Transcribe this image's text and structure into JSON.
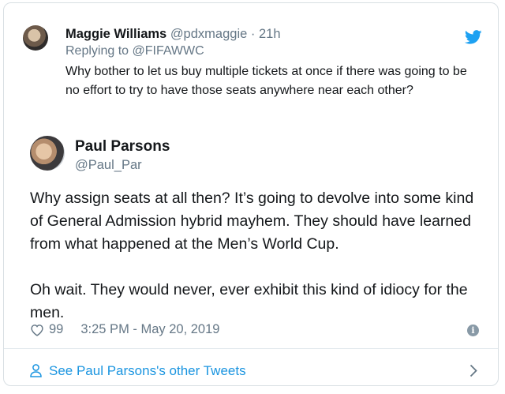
{
  "replied_tweet": {
    "name": "Maggie Williams",
    "handle": "@pdxmaggie",
    "separator": "·",
    "time": "21h",
    "replying_prefix": "Replying to",
    "replying_to": "@FIFAWWC",
    "text": "Why bother to let us buy multiple tickets at once if there was going to be no effort to try to have those seats anywhere near each other?"
  },
  "tweet": {
    "name": "Paul Parsons",
    "handle": "@Paul_Par",
    "paragraphs": [
      "Why assign seats at all then? It’s going to devolve into some kind of General Admission hybrid mayhem. They should have learned from what happened at the Men’s World Cup.",
      "Oh wait. They would never, ever exhibit this kind of idiocy for the men."
    ],
    "likes": "99",
    "timestamp": "3:25 PM - May 20, 2019"
  },
  "footer": {
    "label": "See Paul Parsons's other Tweets"
  },
  "colors": {
    "twitter_blue": "#1da1f2",
    "link_blue": "#1b95e0",
    "secondary_text": "#657786",
    "border": "#d8dfe3"
  },
  "icons": [
    "twitter-bird-icon",
    "heart-icon",
    "info-icon",
    "person-icon",
    "chevron-right-icon"
  ]
}
